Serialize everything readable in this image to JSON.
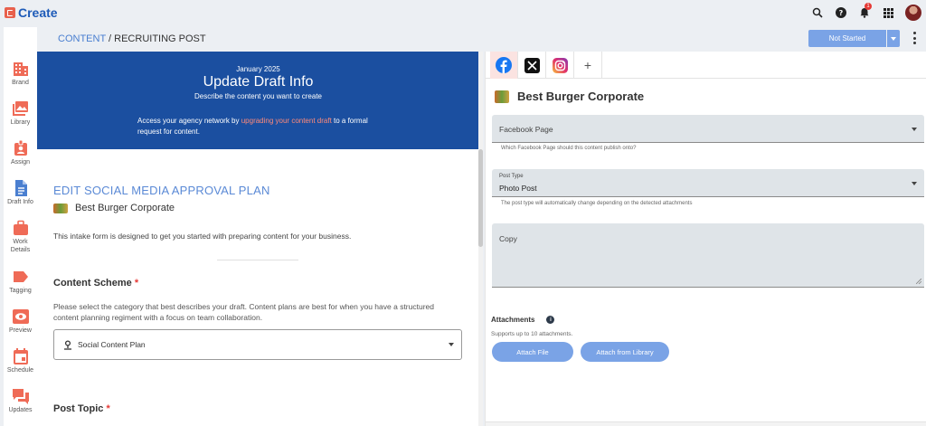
{
  "app": {
    "name": "Create",
    "notification_count": "1"
  },
  "colors": {
    "brand_blue": "#1b4fa0",
    "accent_orange": "#e8604c",
    "button_blue": "#7aa3e6",
    "required_red": "#e53935"
  },
  "icons": {
    "search": "search-icon",
    "help": "help-icon",
    "bell": "bell-icon",
    "apps": "apps-grid-icon"
  },
  "sidebar": {
    "items": [
      {
        "label": "Brand",
        "icon": "building-icon"
      },
      {
        "label": "Library",
        "icon": "image-library-icon"
      },
      {
        "label": "Assign",
        "icon": "assign-badge-icon"
      },
      {
        "label": "Draft Info",
        "icon": "document-icon"
      },
      {
        "label": "Work Details",
        "icon": "briefcase-icon"
      },
      {
        "label": "Tagging",
        "icon": "tag-icon"
      },
      {
        "label": "Preview",
        "icon": "eye-icon"
      },
      {
        "label": "Schedule",
        "icon": "calendar-icon"
      },
      {
        "label": "Updates",
        "icon": "chat-icon"
      }
    ]
  },
  "breadcrumb": {
    "section": "CONTENT",
    "separator": "/",
    "page": "RECRUITING POST"
  },
  "status": {
    "label": "Not Started"
  },
  "hero": {
    "date": "January 2025",
    "title": "Update Draft Info",
    "subtitle": "Describe the content you want to create",
    "note_prefix": "Access your agency network by ",
    "note_link": "upgrading your content draft",
    "note_suffix": " to a formal request for content."
  },
  "form": {
    "section_title": "EDIT SOCIAL MEDIA APPROVAL PLAN",
    "brand_name": "Best Burger Corporate",
    "intro": "This intake form is designed to get you started with preparing content for your business.",
    "content_scheme": {
      "label": "Content Scheme",
      "required": "*",
      "description": "Please select the category that best describes your draft. Content plans are best for when you have a structured content planning regiment with a focus on team collaboration.",
      "value": "Social Content Plan"
    },
    "post_topic": {
      "label": "Post Topic",
      "required": "*"
    }
  },
  "social": {
    "tabs": [
      {
        "name": "facebook",
        "icon": "facebook-icon",
        "active": true
      },
      {
        "name": "x",
        "icon": "x-icon",
        "active": false
      },
      {
        "name": "instagram",
        "icon": "instagram-icon",
        "active": false
      },
      {
        "name": "add",
        "label": "+",
        "icon": "plus-icon",
        "active": false
      }
    ],
    "brand_name": "Best Burger Corporate",
    "facebook_page": {
      "label": "Facebook Page",
      "hint": "Which Facebook Page should this content publish onto?"
    },
    "post_type": {
      "label": "Post Type",
      "value": "Photo Post",
      "hint": "The post type will automatically change depending on the detected attachments"
    },
    "copy": {
      "label": "Copy"
    },
    "attachments": {
      "title": "Attachments",
      "info_glyph": "i",
      "subtitle": "Supports up to 10 attachments.",
      "attach_file": "Attach File",
      "attach_library": "Attach from Library"
    }
  }
}
